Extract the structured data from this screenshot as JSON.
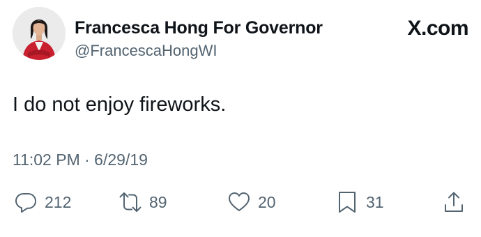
{
  "tweet": {
    "author_name": "Francesca Hong For Governor",
    "author_handle": "@FrancescaHongWI",
    "text": "I do not enjoy fireworks.",
    "timestamp": "11:02 PM · 6/29/19",
    "brand": "X.com"
  },
  "actions": {
    "replies": "212",
    "reposts": "89",
    "likes": "20",
    "bookmarks": "31"
  },
  "icons": {
    "reply": "reply-icon",
    "repost": "repost-icon",
    "like": "heart-icon",
    "bookmark": "bookmark-icon",
    "share": "share-icon"
  },
  "colors": {
    "text": "#0f1419",
    "secondary": "#536471",
    "avatar_jacket": "#c8202f"
  }
}
